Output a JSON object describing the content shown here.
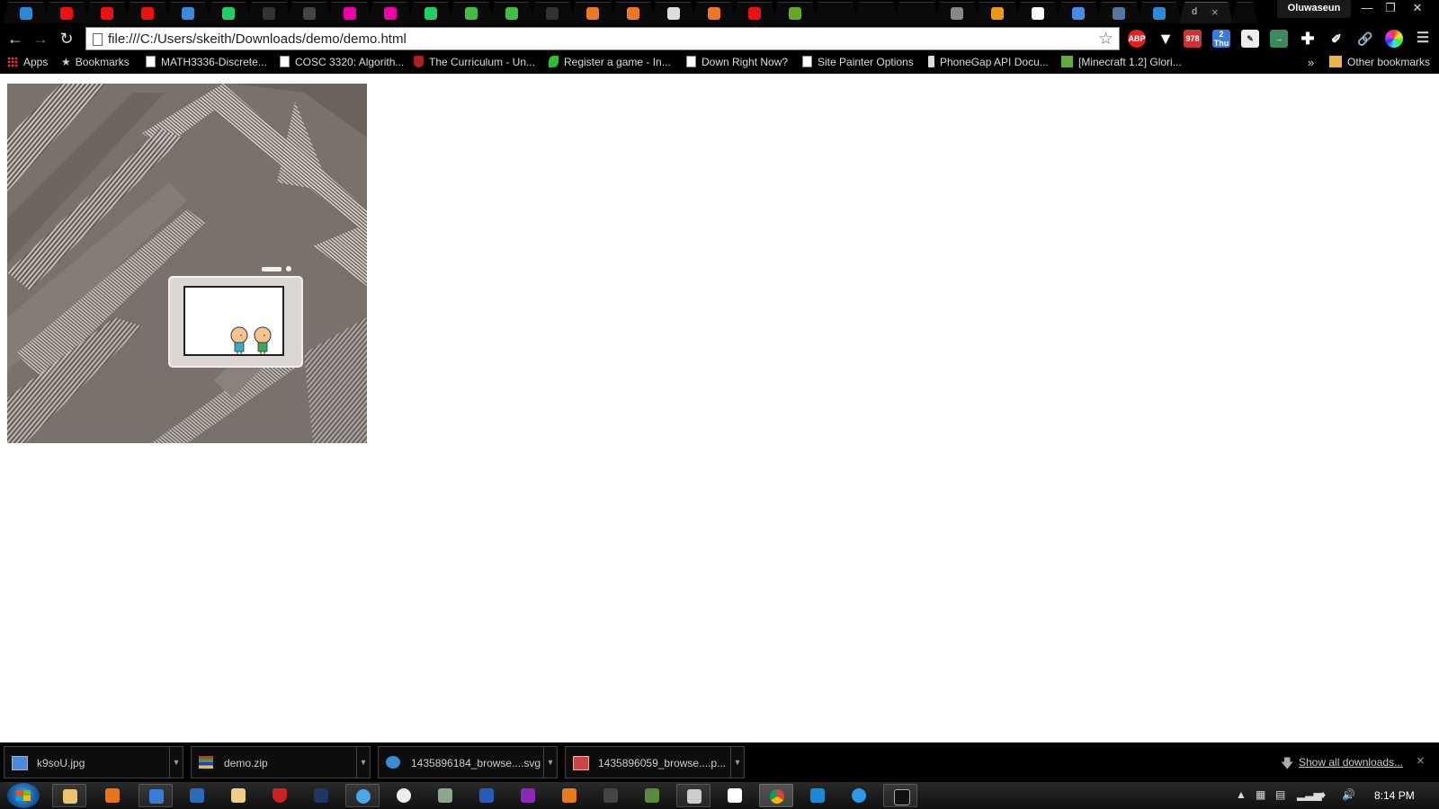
{
  "browser": {
    "profile_name": "Oluwaseun",
    "active_tab_title": "d",
    "tab_favicon_colors": [
      "#2a8ad8",
      "#e11",
      "#e11",
      "#e11",
      "#3a8ad8",
      "#2c6",
      "#333",
      "#444",
      "#e0a",
      "#e0a",
      "#2c6",
      "#4b4",
      "#4b4",
      "#333",
      "#e72",
      "#e72",
      "#ddd",
      "#e72",
      "#e11",
      "#6a2",
      "",
      "",
      "",
      "#888",
      "#e91",
      "#fff",
      "#4a8ae8",
      "#579",
      "#2a8ad8"
    ],
    "window_controls": [
      "minimize",
      "restore",
      "close"
    ]
  },
  "toolbar": {
    "url": "file:///C:/Users/skeith/Downloads/demo/demo.html",
    "gmail_badge": "978",
    "calendar_badge": "2",
    "calendar_day": "Thu",
    "abp_label": "ABP"
  },
  "bookmarks_bar": {
    "items": [
      {
        "label": "Apps",
        "icon": "apps-grid-icon"
      },
      {
        "label": "Bookmarks",
        "icon": "star-icon"
      },
      {
        "label": "MATH3336-Discrete...",
        "icon": "page-icon"
      },
      {
        "label": "COSC 3320: Algorith...",
        "icon": "page-icon"
      },
      {
        "label": "The Curriculum - Un...",
        "icon": "shield-icon"
      },
      {
        "label": "Register a game - In...",
        "icon": "leaf-icon"
      },
      {
        "label": "Down Right Now?",
        "icon": "page-icon"
      },
      {
        "label": "Site Painter Options",
        "icon": "page-icon"
      },
      {
        "label": "PhoneGap API Docu...",
        "icon": "phone-icon"
      },
      {
        "label": "[Minecraft 1.2] Glori...",
        "icon": "cube-icon"
      }
    ],
    "overflow": "»",
    "other_bookmarks": "Other bookmarks"
  },
  "downloads": {
    "items": [
      {
        "name": "k9soU.jpg",
        "icon": "image-file-icon"
      },
      {
        "name": "demo.zip",
        "icon": "archive-icon"
      },
      {
        "name": "1435896184_browse....svg",
        "icon": "ie-file-icon"
      },
      {
        "name": "1435896059_browse....p...",
        "icon": "image-file-icon"
      }
    ],
    "show_all": "Show all downloads...",
    "close": "×"
  },
  "taskbar": {
    "clock": "8:14 PM",
    "apps": [
      "explorer",
      "media-player",
      "notepad",
      "intel-xdk",
      "paint",
      "antivirus",
      "terminal",
      "chrome-pinned",
      "obs",
      "network",
      "word",
      "onenote",
      "sublime",
      "pen",
      "minecraft",
      "calculator",
      "calendar",
      "chrome",
      "utility",
      "support",
      "cmd"
    ]
  },
  "page": {
    "canvas_description": "demo canvas",
    "colors": {
      "canvas_bg": "#7a716c",
      "stripe_light": "#d8d2ce",
      "stripe_dark": "#5a524e",
      "skin": "#f6c48a",
      "shirt_blue": "#39a8c9",
      "shirt_green": "#3aa65a"
    }
  }
}
